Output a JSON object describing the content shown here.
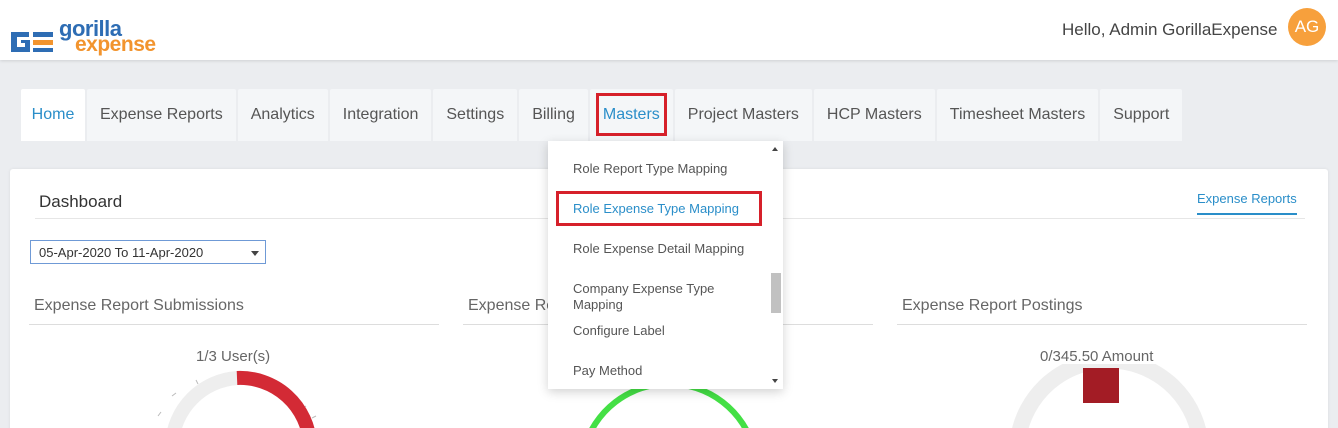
{
  "header": {
    "logo_word1": "gorilla",
    "logo_word2": "expense",
    "greeting": "Hello, Admin GorillaExpense",
    "avatar_initials": "AG"
  },
  "nav": {
    "tabs": [
      {
        "label": "Home"
      },
      {
        "label": "Expense Reports"
      },
      {
        "label": "Analytics"
      },
      {
        "label": "Integration"
      },
      {
        "label": "Settings"
      },
      {
        "label": "Billing"
      },
      {
        "label": "Masters"
      },
      {
        "label": "Project Masters"
      },
      {
        "label": "HCP Masters"
      },
      {
        "label": "Timesheet Masters"
      },
      {
        "label": "Support"
      }
    ],
    "active_tab": "Home"
  },
  "masters_menu": {
    "items": [
      {
        "label": "Role Report Type Mapping"
      },
      {
        "label": "Role Expense Type Mapping"
      },
      {
        "label": "Role Expense Detail Mapping"
      },
      {
        "label": "Company Expense Type Mapping"
      },
      {
        "label": "Configure Label"
      },
      {
        "label": "Pay Method"
      }
    ]
  },
  "dashboard": {
    "title": "Dashboard",
    "expense_reports_link": "Expense Reports",
    "date_range": "05-Apr-2020 To 11-Apr-2020",
    "panels": [
      {
        "title": "Expense Report Submissions",
        "metric": "1/3 User(s)"
      },
      {
        "title": "Expense Re",
        "metric": ""
      },
      {
        "title": "Expense Report Postings",
        "metric": "0/345.50 Amount"
      }
    ]
  },
  "colors": {
    "accent": "#2a8ec9",
    "highlight": "#d6202a",
    "gauge_red": "#d32a35",
    "gauge_green": "#44e045",
    "avatar": "#f7a03c",
    "logo_blue": "#2e6db4",
    "logo_orange": "#f2942e"
  }
}
